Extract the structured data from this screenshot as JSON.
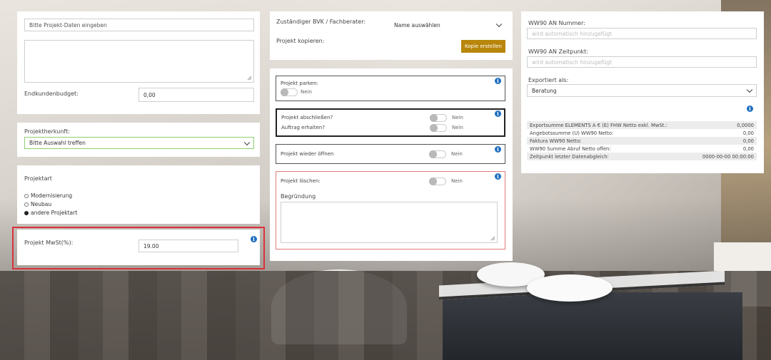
{
  "left": {
    "project_data_placeholder": "Bitte Projekt-Daten eingeben",
    "endkundenbudget_label": "Endkundenbudget:",
    "endkundenbudget_value": "0,00",
    "projektherkunft_label": "Projektherkunft:",
    "projektherkunft_value": "Bitte Auswahl treffen",
    "projektart_label": "Projektart",
    "projektart_options": [
      "Modernisierung",
      "Neubau",
      "andere Projektart"
    ],
    "projektart_selected": "andere Projektart",
    "mwst_label": "Projekt MwSt(%):",
    "mwst_value": "19.00",
    "highlight_color": "#d9323a"
  },
  "middle": {
    "bvk_label": "Zuständiger BVK / Fachberater:",
    "bvk_value": "Name auswählen",
    "kopieren_label": "Projekt kopieren:",
    "kopie_button": "Kopie erstellen",
    "kopie_button_color": "#b8860b",
    "parken_label": "Projekt parken:",
    "parken_value": "Nein",
    "abschliessen_label": "Projekt abschließen?",
    "abschliessen_value": "Nein",
    "auftrag_label": "Auftrag erhalten?",
    "auftrag_value": "Nein",
    "oeffnen_label": "Projekt wieder öffnen",
    "oeffnen_value": "Nein",
    "loeschen_label": "Projekt löschen:",
    "loeschen_value": "Nein",
    "begruendung_label": "Begründung"
  },
  "right": {
    "an_nummer_label": "WW90 AN Nummer:",
    "an_nummer_placeholder": "wird automatisch hinzugefügt",
    "an_zeitpunkt_label": "WW90 AN Zeitpunkt:",
    "an_zeitpunkt_placeholder": "wird automatisch hinzugefügt",
    "exportiert_label": "Exportiert als:",
    "exportiert_value": "Beratung",
    "summary": [
      {
        "label": "Exportsumme ELEMENTS A € (E) FHW Netto exkl. MwSt.:",
        "value": "0,0000"
      },
      {
        "label": "Angebotssumme (U) WW90 Netto:",
        "value": "0,00"
      },
      {
        "label": "Faktura WW90 Netto:",
        "value": "0,00"
      },
      {
        "label": "WW90 Summe Abruf Netto offen:",
        "value": "0,00"
      },
      {
        "label": "Zeitpunkt letzter Datenabgleich:",
        "value": "0000-00-00 00:00:00"
      }
    ]
  },
  "icons": {
    "info": "i"
  }
}
